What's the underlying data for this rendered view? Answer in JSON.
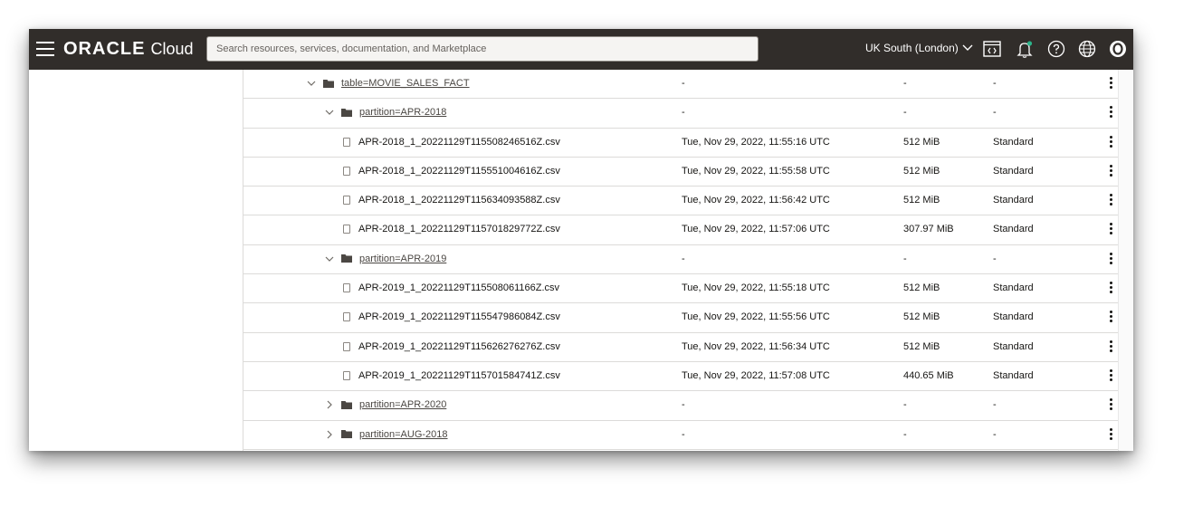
{
  "header": {
    "logo_main": "ORACLE",
    "logo_sub": "Cloud",
    "search_placeholder": "Search resources, services, documentation, and Marketplace",
    "region": "UK South (London)",
    "icons": [
      "menu-icon",
      "cloud-shell-icon",
      "bell-icon",
      "help-icon",
      "globe-icon",
      "profile-icon"
    ],
    "accent_color": "#2cb38a"
  },
  "rows": [
    {
      "type": "folder",
      "expanded": true,
      "level": 0,
      "name": "table=MOVIE_SALES_FACT",
      "modified": "-",
      "size": "-",
      "tier": "-"
    },
    {
      "type": "folder",
      "expanded": true,
      "level": 1,
      "name": "partition=APR-2018",
      "modified": "-",
      "size": "-",
      "tier": "-"
    },
    {
      "type": "file",
      "level": 2,
      "name": "APR-2018_1_20221129T115508246516Z.csv",
      "modified": "Tue, Nov 29, 2022, 11:55:16 UTC",
      "size": "512 MiB",
      "tier": "Standard"
    },
    {
      "type": "file",
      "level": 2,
      "name": "APR-2018_1_20221129T115551004616Z.csv",
      "modified": "Tue, Nov 29, 2022, 11:55:58 UTC",
      "size": "512 MiB",
      "tier": "Standard"
    },
    {
      "type": "file",
      "level": 2,
      "name": "APR-2018_1_20221129T115634093588Z.csv",
      "modified": "Tue, Nov 29, 2022, 11:56:42 UTC",
      "size": "512 MiB",
      "tier": "Standard"
    },
    {
      "type": "file",
      "level": 2,
      "name": "APR-2018_1_20221129T115701829772Z.csv",
      "modified": "Tue, Nov 29, 2022, 11:57:06 UTC",
      "size": "307.97 MiB",
      "tier": "Standard"
    },
    {
      "type": "folder",
      "expanded": true,
      "level": 1,
      "name": "partition=APR-2019",
      "modified": "-",
      "size": "-",
      "tier": "-"
    },
    {
      "type": "file",
      "level": 2,
      "name": "APR-2019_1_20221129T115508061166Z.csv",
      "modified": "Tue, Nov 29, 2022, 11:55:18 UTC",
      "size": "512 MiB",
      "tier": "Standard"
    },
    {
      "type": "file",
      "level": 2,
      "name": "APR-2019_1_20221129T115547986084Z.csv",
      "modified": "Tue, Nov 29, 2022, 11:55:56 UTC",
      "size": "512 MiB",
      "tier": "Standard"
    },
    {
      "type": "file",
      "level": 2,
      "name": "APR-2019_1_20221129T115626276276Z.csv",
      "modified": "Tue, Nov 29, 2022, 11:56:34 UTC",
      "size": "512 MiB",
      "tier": "Standard"
    },
    {
      "type": "file",
      "level": 2,
      "name": "APR-2019_1_20221129T115701584741Z.csv",
      "modified": "Tue, Nov 29, 2022, 11:57:08 UTC",
      "size": "440.65 MiB",
      "tier": "Standard"
    },
    {
      "type": "folder",
      "expanded": false,
      "level": 1,
      "name": "partition=APR-2020",
      "modified": "-",
      "size": "-",
      "tier": "-"
    },
    {
      "type": "folder",
      "expanded": false,
      "level": 1,
      "name": "partition=AUG-2018",
      "modified": "-",
      "size": "-",
      "tier": "-"
    }
  ]
}
